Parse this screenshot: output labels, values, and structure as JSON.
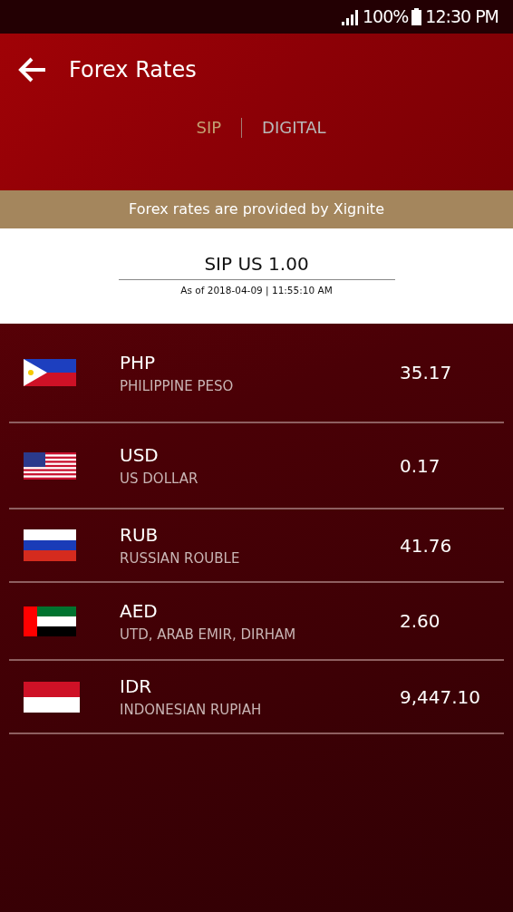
{
  "status_bar": {
    "battery": "100%",
    "time": "12:30 PM"
  },
  "header": {
    "title": "Forex Rates"
  },
  "tabs": [
    {
      "label": "SIP",
      "selected": true
    },
    {
      "label": "DIGITAL",
      "selected": false
    }
  ],
  "notice": "Forex rates are provided by Xignite",
  "base": {
    "title": "SIP US 1.00",
    "as_of": "As of 2018-04-09 | 11:55:10 AM"
  },
  "rates": [
    {
      "kind": "philippines",
      "code": "PHP",
      "name": "PHILIPPINE PESO",
      "rate": "35.17"
    },
    {
      "kind": "usa",
      "code": "USD",
      "name": "US DOLLAR",
      "rate": "0.17"
    },
    {
      "kind": "russia",
      "code": "RUB",
      "name": "RUSSIAN ROUBLE",
      "rate": "41.76"
    },
    {
      "kind": "uae",
      "code": "AED",
      "name": "UTD, ARAB EMIR, DIRHAM",
      "rate": "2.60"
    },
    {
      "kind": "indonesia",
      "code": "IDR",
      "name": "INDONESIAN RUPIAH",
      "rate": "9,447.10"
    }
  ]
}
